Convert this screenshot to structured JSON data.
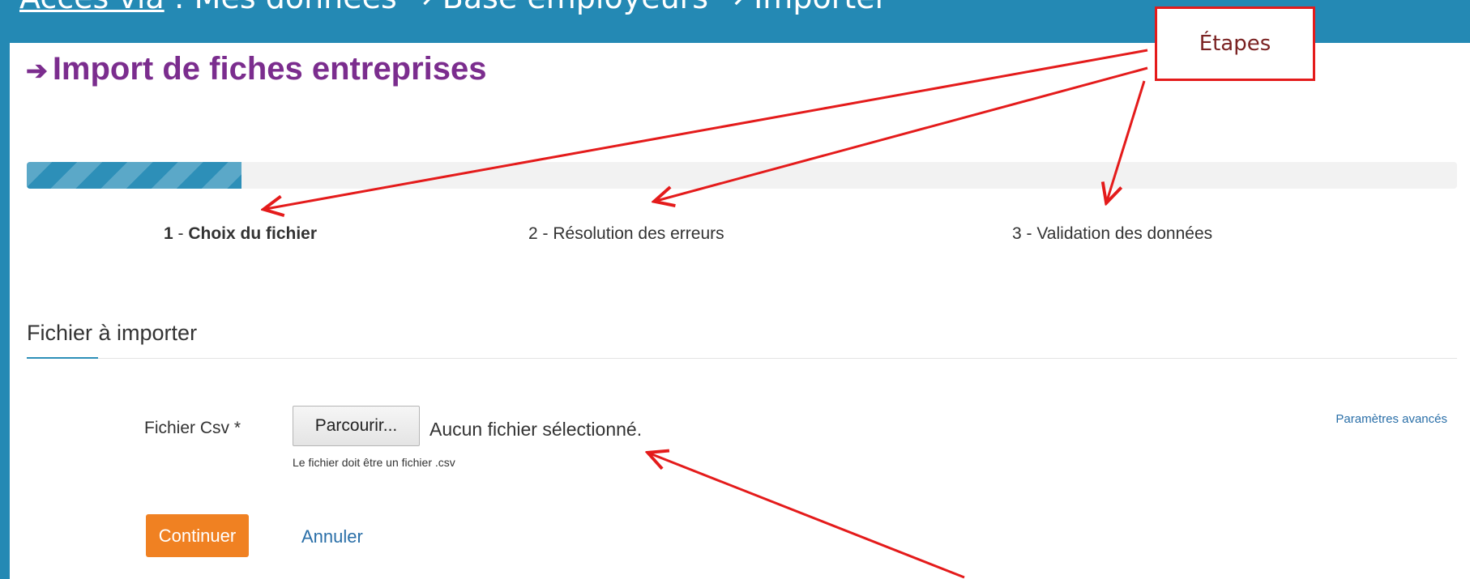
{
  "slide": {
    "breadcrumb_link": "Accès via",
    "breadcrumb_rest": " : Mes données → Base employeurs → Importer"
  },
  "page": {
    "title": "Import de fiches entreprises",
    "progress_percent": 15
  },
  "steps": [
    {
      "num": "1",
      "sep": " - ",
      "label": "Choix du fichier"
    },
    {
      "num": "2",
      "sep": " - ",
      "label": "Résolution des erreurs"
    },
    {
      "num": "3",
      "sep": " - ",
      "label": "Validation des données"
    }
  ],
  "section": {
    "title": "Fichier à importer"
  },
  "form": {
    "field_label": "Fichier Csv *",
    "browse_label": "Parcourir...",
    "no_file": "Aucun fichier sélectionné.",
    "help": "Le fichier doit être un fichier .csv",
    "advanced": "Paramètres avancés",
    "continue": "Continuer",
    "cancel": "Annuler"
  },
  "annotation": {
    "label": "Étapes"
  },
  "colors": {
    "header_bg": "#2489b4",
    "title": "#7b2d8e",
    "progress": "#2d8fb8",
    "button": "#f08122",
    "link": "#2a6fa8",
    "annotation": "#e41b1b"
  }
}
